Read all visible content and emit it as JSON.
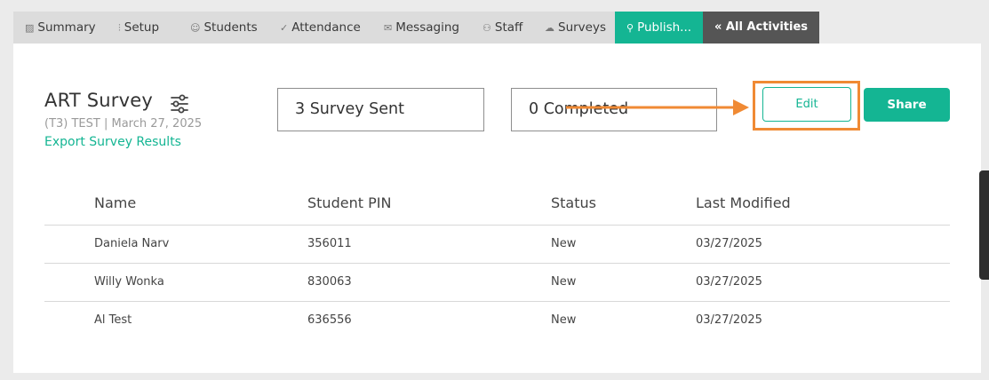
{
  "tabs": [
    {
      "label": "Summary",
      "icon": "chart-icon"
    },
    {
      "label": "Setup",
      "icon": "sliders-icon"
    },
    {
      "label": "Students",
      "icon": "user-icon"
    },
    {
      "label": "Attendance",
      "icon": "check-icon"
    },
    {
      "label": "Messaging",
      "icon": "envelope-icon"
    },
    {
      "label": "Staff",
      "icon": "users-icon"
    },
    {
      "label": "Surveys",
      "icon": "cloud-icon"
    },
    {
      "label": "Publish...",
      "icon": "link-icon",
      "active": true
    },
    {
      "label": "« All Activities"
    }
  ],
  "survey": {
    "title": "ART Survey",
    "subtitle": "(T3) TEST | March 27, 2025",
    "export_link": "Export Survey Results"
  },
  "stats": {
    "sent": "3 Survey Sent",
    "completed": "0 Completed"
  },
  "buttons": {
    "edit": "Edit",
    "share": "Share"
  },
  "table": {
    "headers": [
      "Name",
      "Student PIN",
      "Status",
      "Last Modified"
    ],
    "rows": [
      [
        "Daniela Narv",
        "356011",
        "New",
        "03/27/2025"
      ],
      [
        "Willy Wonka",
        "830063",
        "New",
        "03/27/2025"
      ],
      [
        "Al Test",
        "636556",
        "New",
        "03/27/2025"
      ]
    ]
  },
  "colors": {
    "accent": "#14b593",
    "annotation": "#f08a34",
    "dark_tab": "#555555"
  }
}
